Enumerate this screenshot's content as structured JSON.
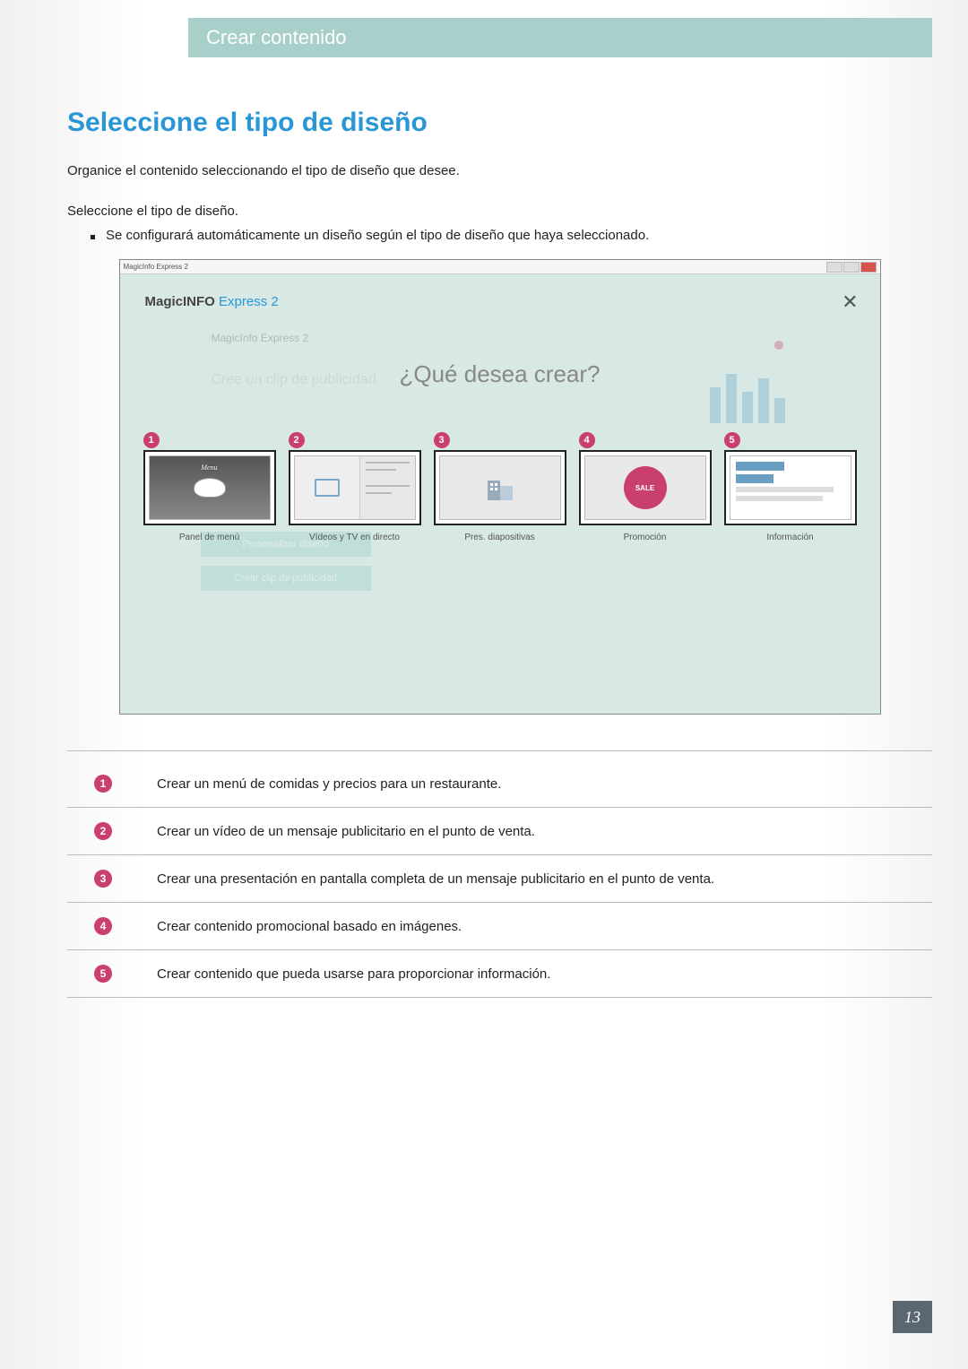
{
  "header": {
    "breadcrumb": "Crear contenido"
  },
  "section": {
    "title": "Seleccione el tipo de diseño",
    "intro": "Organice el contenido seleccionando el tipo de diseño que desee.",
    "step": "Seleccione el tipo de diseño.",
    "bullet": "Se configurará automáticamente un diseño según el tipo de diseño que haya seleccionado."
  },
  "screenshot": {
    "window_title": "MagicInfo Express 2",
    "logo_prefix": "Magic",
    "logo_mid": "INFO",
    "logo_suffix": " Express 2",
    "faded_label": "MagicInfo Express 2",
    "faded_subtitle": "Cree un clip de publicidad",
    "faded_btn1": "Personalizar diseño",
    "faded_btn2": "Crear clip de publicidad",
    "modal_question": "¿Qué desea crear?",
    "cards": [
      {
        "num": "1",
        "label": "Panel de menú",
        "menu_text": "Menu"
      },
      {
        "num": "2",
        "label": "Vídeos y TV en directo"
      },
      {
        "num": "3",
        "label": "Pres. diapositivas"
      },
      {
        "num": "4",
        "label": "Promoción",
        "badge": "SALE"
      },
      {
        "num": "5",
        "label": "Información"
      }
    ]
  },
  "legend": [
    {
      "num": "1",
      "text": "Crear un menú de comidas y precios para un restaurante."
    },
    {
      "num": "2",
      "text": "Crear un vídeo de un mensaje publicitario en el punto de venta."
    },
    {
      "num": "3",
      "text": "Crear una presentación en pantalla completa de un mensaje publicitario en el punto de venta."
    },
    {
      "num": "4",
      "text": "Crear contenido promocional basado en imágenes."
    },
    {
      "num": "5",
      "text": "Crear contenido que pueda usarse para proporcionar información."
    }
  ],
  "page_number": "13"
}
